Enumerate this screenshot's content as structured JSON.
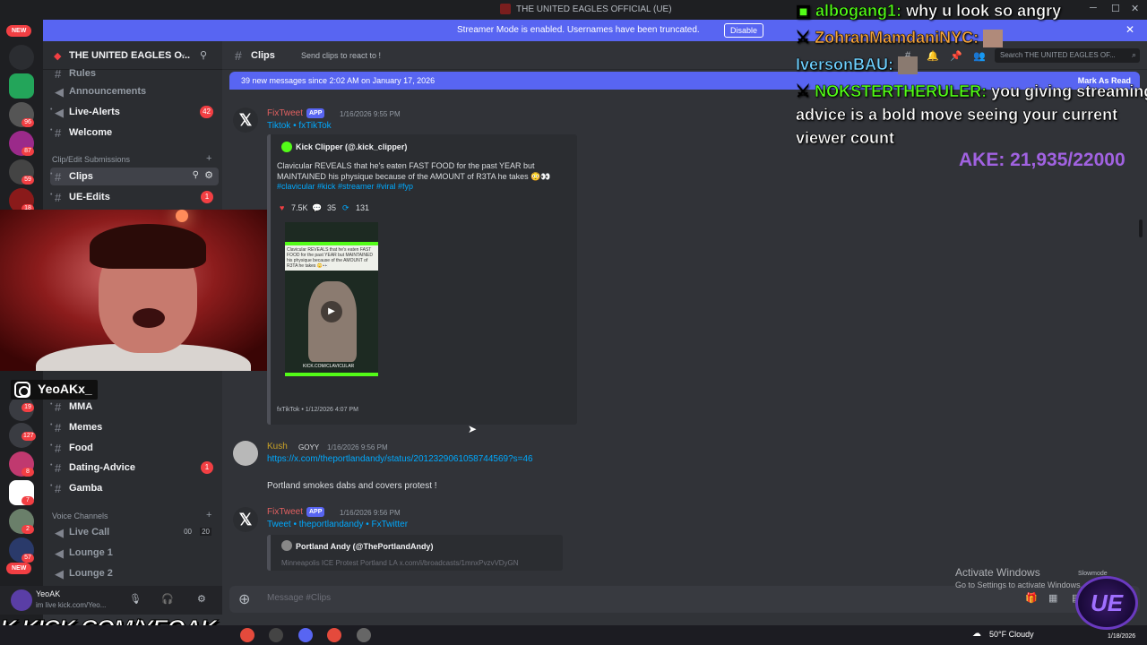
{
  "window": {
    "title": "THE UNITED EAGLES OFFICIAL (UE)"
  },
  "banner": {
    "text": "Streamer Mode is enabled. Usernames have been truncated.",
    "button": "Disable"
  },
  "rail": {
    "new_top": "NEW",
    "new_bottom": "NEW",
    "badges": [
      "96",
      "87",
      "59",
      "18",
      "13",
      "19",
      "127",
      "8",
      "7",
      "2",
      "57",
      "57"
    ]
  },
  "server": {
    "name": "THE UNITED EAGLES O..."
  },
  "channels": {
    "rules": "Rules",
    "announcements": "Announcements",
    "live_alerts": "Live-Alerts",
    "live_alerts_badge": "42",
    "welcome": "Welcome",
    "cat_clip": "Clip/Edit Submissions",
    "clips": "Clips",
    "ue_edits": "UE-Edits",
    "ue_edits_badge": "1",
    "mma": "MMA",
    "memes": "Memes",
    "food": "Food",
    "dating": "Dating-Advice",
    "dating_badge": "1",
    "gamba": "Gamba",
    "cat_voice": "Voice Channels",
    "live_call": "Live Call",
    "live_call_a": "00",
    "live_call_b": "20",
    "lounge1": "Lounge 1",
    "lounge2": "Lounge 2"
  },
  "user": {
    "name": "YeoAK",
    "status": "im live kick.com/Yeo..."
  },
  "stream": {
    "instagram": "YeoAKx_",
    "kick": "K KICK.COM/YEOAK"
  },
  "channel_header": {
    "name": "Clips",
    "topic": "Send clips to react to !",
    "search": "Search THE UNITED EAGLES OF..."
  },
  "newbar": {
    "text": "39 new messages since 2:02 AM on January 17, 2026",
    "mark": "Mark As Read"
  },
  "messages": {
    "m1": {
      "author": "FixTweet",
      "app": "APP",
      "time": "1/16/2026 9:55 PM",
      "links": "Tiktok • fxTikTok",
      "embed_author": "Kick Clipper (@.kick_clipper)",
      "embed_text": "Clavicular REVEALS that he's eaten FAST FOOD for the past YEAR but MAINTAINED his physique because of the AMOUNT of R3TA he takes 😳👀",
      "embed_tags": "#clavicular #kick #streamer #viral #fyp",
      "likes": "7.5K",
      "comments": "35",
      "shares": "131",
      "thumb_text": "Clavicular REVEALS that he's eaten FAST FOOD for the past YEAR but MAINTAINED his physique because of the AMOUNT of R3TA he takes 😳👀",
      "thumb_watermark": "KICK.COM/CLAVICULAR",
      "footer": "fxTikTok • 1/12/2026 4:07 PM"
    },
    "m2": {
      "author": "Kush",
      "role": "GOYY",
      "time": "1/16/2026 9:56 PM",
      "url": "https://x.com/theportlandandy/status/2012329061058744569?s=46",
      "text": "Portland smokes dabs and covers protest !"
    },
    "m3": {
      "author": "FixTweet",
      "app": "APP",
      "time": "1/16/2026 9:56 PM",
      "links": "Tweet • theportlandandy • FxTwitter",
      "embed_author": "Portland Andy (@ThePortlandAndy)",
      "embed_text": "Minneapolis ICE Protest Portland LA x.com/i/broadcasts/1mnxPvzvVDyGN"
    }
  },
  "input": {
    "placeholder": "Message #Clips"
  },
  "overlay": {
    "l1_name": "albogang1:",
    "l1_text": "why u look so angry",
    "l2_name": "ZohranMamdaniNYC:",
    "l3_name": "IversonBAU:",
    "l4_name": "NOKSTERTHERULER:",
    "l4_text": "you giving streaming",
    "l5": "advice is a bold move seeing your current",
    "l6": "viewer count",
    "goal": "AKE: 21,935/22000"
  },
  "activate": {
    "title": "Activate Windows",
    "sub": "Go to Settings to activate Windows.",
    "slowmode": "Slowmode"
  },
  "taskbar": {
    "weather": "50°F  Cloudy",
    "time": "",
    "date": "1/18/2026"
  },
  "ue_logo": "UE"
}
